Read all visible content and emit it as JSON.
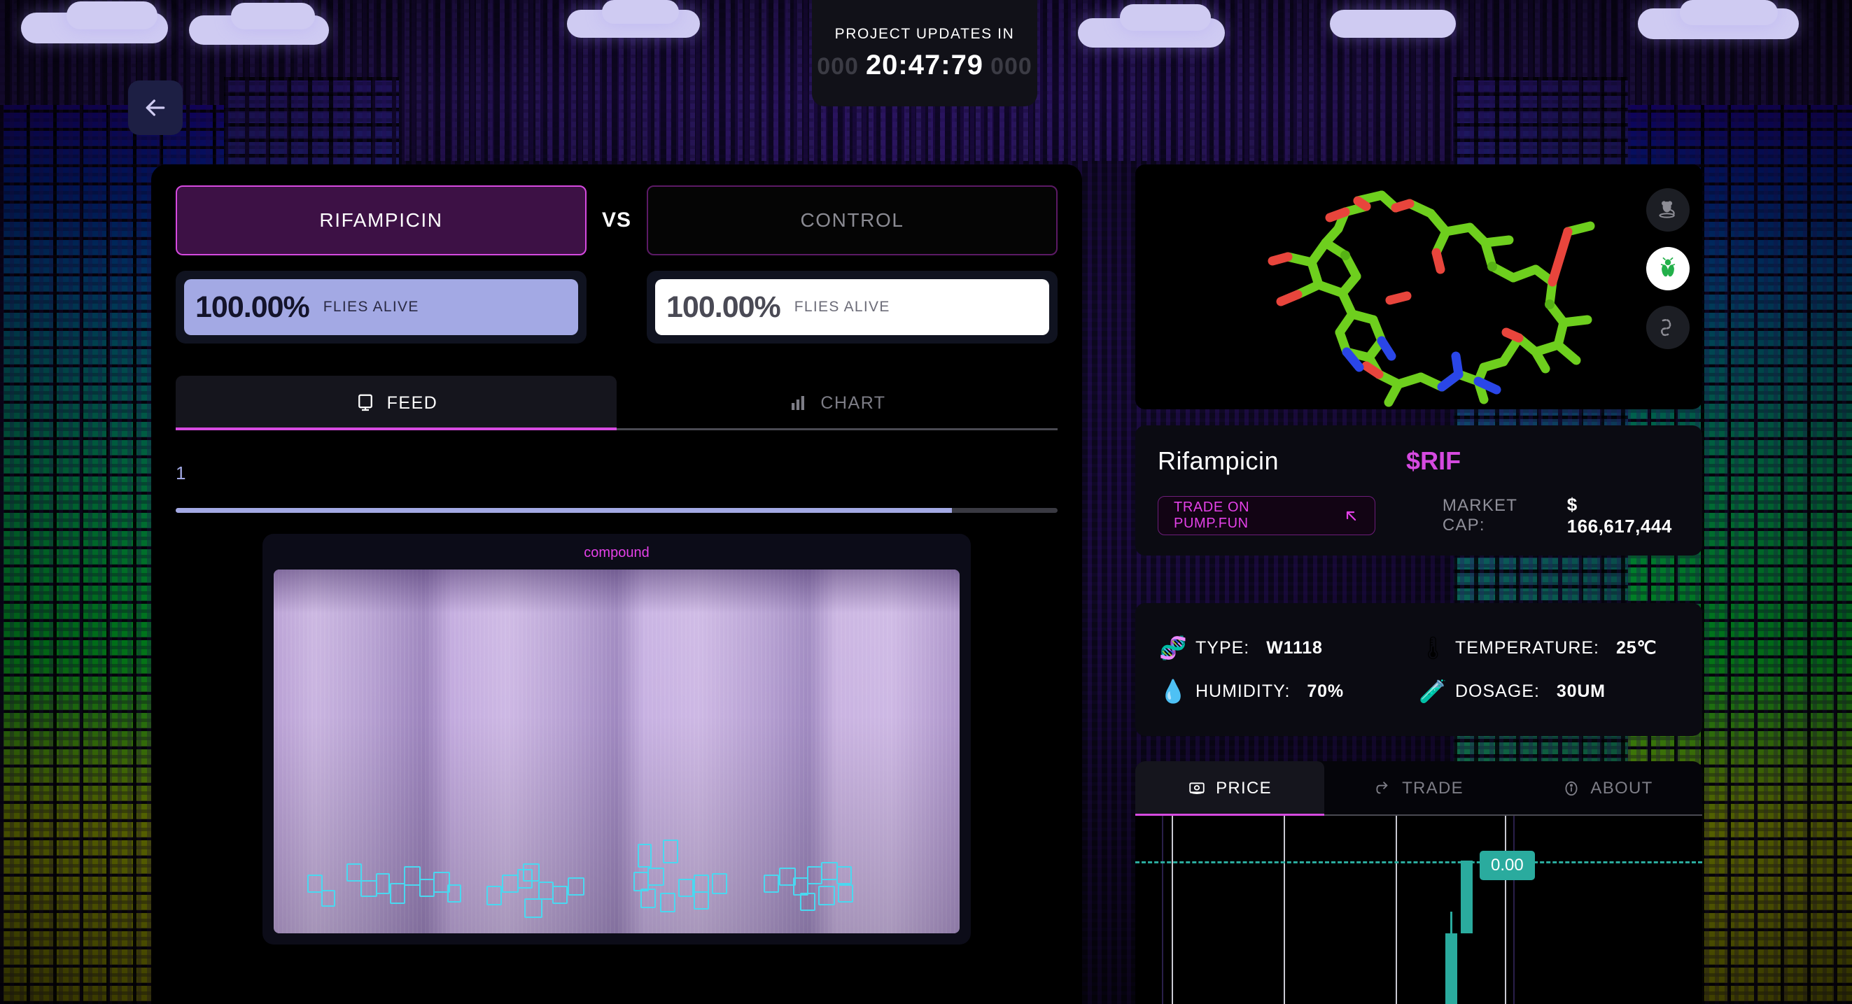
{
  "countdown": {
    "label": "PROJECT UPDATES IN",
    "ghost_left": "000",
    "time": "20:47:79",
    "ghost_right": "000"
  },
  "back_button": {
    "icon": "arrow-left-icon"
  },
  "comparison": {
    "treatment": {
      "label": "RIFAMPICIN",
      "active": true
    },
    "vs_label": "VS",
    "control": {
      "label": "CONTROL",
      "active": false
    }
  },
  "stats": {
    "treatment": {
      "percent": "100.00%",
      "label": "FLIES ALIVE"
    },
    "control": {
      "percent": "100.00%",
      "label": "FLIES ALIVE"
    }
  },
  "view_tabs": [
    {
      "label": "FEED",
      "icon": "monitor-icon",
      "active": true
    },
    {
      "label": "CHART",
      "icon": "bar-chart-icon",
      "active": false
    }
  ],
  "progress": {
    "number": "1",
    "percent": 88
  },
  "feed": {
    "caption": "compound"
  },
  "organisms": [
    {
      "name": "mouse-icon",
      "active": false
    },
    {
      "name": "fly-icon",
      "active": true
    },
    {
      "name": "worm-icon",
      "active": false
    }
  ],
  "token": {
    "name": "Rifampicin",
    "symbol": "$RIF",
    "trade_button": "TRADE ON PUMP.FUN",
    "trade_icon": "arrow-up-left-icon",
    "market_cap_label": "MARKET CAP:",
    "market_cap_value": "$ 166,617,444"
  },
  "experiment_info": [
    {
      "icon": "dna-icon",
      "glyph": "🧬",
      "key": "TYPE:",
      "value": "W1118"
    },
    {
      "icon": "thermometer-icon",
      "glyph": "🌡",
      "key": "TEMPERATURE:",
      "value": "25℃"
    },
    {
      "icon": "droplet-icon",
      "glyph": "💧",
      "key": "HUMIDITY:",
      "value": "70%"
    },
    {
      "icon": "test-tube-icon",
      "glyph": "🧪",
      "key": "DOSAGE:",
      "value": "30UM"
    }
  ],
  "detail_tabs": [
    {
      "label": "PRICE",
      "icon": "price-tag-icon",
      "active": true
    },
    {
      "label": "TRADE",
      "icon": "swap-arrow-icon",
      "active": false
    },
    {
      "label": "ABOUT",
      "icon": "info-circle-icon",
      "active": false
    }
  ],
  "chart_data": {
    "type": "candlestick",
    "title": "PRICE",
    "current_price_label": "0.00",
    "gridlines_x": [
      4,
      25,
      54,
      83,
      91
    ],
    "price_line_value": "0.00",
    "candles": [
      {
        "index": 0,
        "color": "#2aab9e",
        "open": 0.0,
        "close": 0.0,
        "high": 0.0,
        "low": 0.0
      },
      {
        "index": 1,
        "color": "#2aab9e",
        "open": 0.0,
        "close": 0.0,
        "high": 0.0,
        "low": 0.0
      }
    ],
    "accent_color": "#2aab9e"
  },
  "colors": {
    "accent_magenta": "#d64ae0",
    "accent_teal": "#2aab9e",
    "periwinkle": "#a3a9e4",
    "panel_bg": "#0b0b12"
  }
}
